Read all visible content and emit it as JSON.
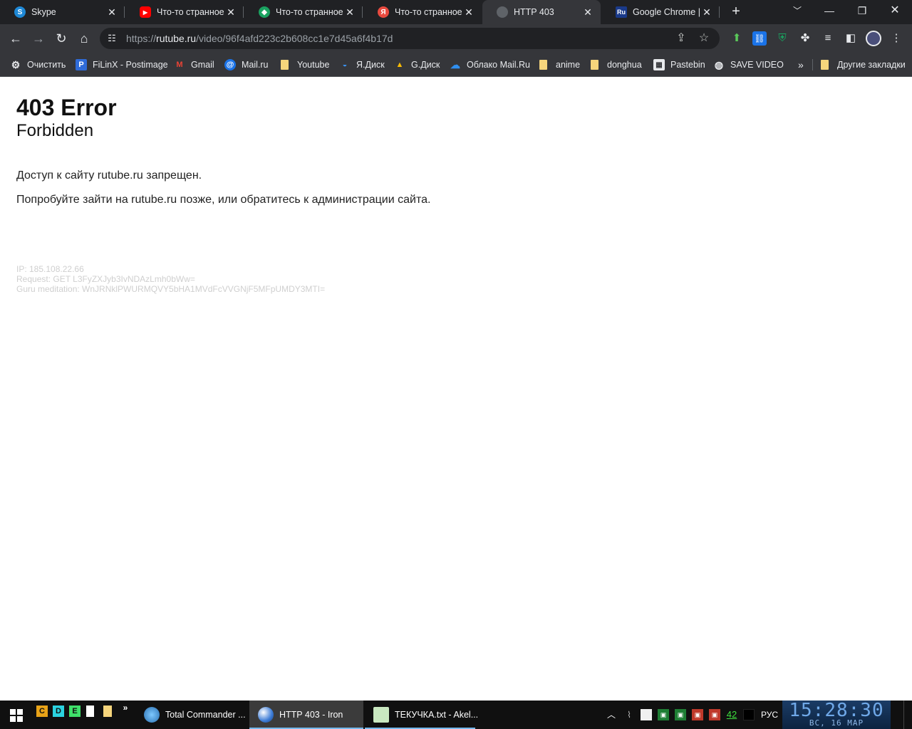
{
  "tabs": [
    {
      "title": "Skype",
      "icon": "skype-icon",
      "color": "#1e88d6",
      "glyph": "S"
    },
    {
      "title": "Что-то странное п",
      "icon": "youtube-icon",
      "color": "#ff0000",
      "glyph": "▶"
    },
    {
      "title": "Что-то странное п",
      "icon": "green-app-icon",
      "color": "#1aa260",
      "glyph": "◆"
    },
    {
      "title": "Что-то странное п",
      "icon": "yandex-icon",
      "color": "#e84a3f",
      "glyph": "Я"
    },
    {
      "title": "HTTP 403",
      "icon": "globe-icon",
      "color": "#5f6368",
      "glyph": "●"
    },
    {
      "title": "Google Chrome | С",
      "icon": "ru-site-icon",
      "color": "#1a3a8a",
      "glyph": "Ru"
    }
  ],
  "toolbar": {
    "url_scheme": "https://",
    "url_host": "rutube.ru",
    "url_path": "/video/96f4afd223c2b608cc1e7d45a6f4b17d"
  },
  "bookmarks": [
    {
      "label": "Очистить",
      "icon": "gear-icon"
    },
    {
      "label": "FiLinX - Postimage",
      "icon": "postimage-icon"
    },
    {
      "label": "Gmail",
      "icon": "gmail-icon"
    },
    {
      "label": "Mail.ru",
      "icon": "at-icon"
    },
    {
      "label": "Youtube",
      "icon": "folder-icon"
    },
    {
      "label": "Я.Диск",
      "icon": "yadisk-icon"
    },
    {
      "label": "G.Диск",
      "icon": "gdrive-icon"
    },
    {
      "label": "Облако Mail.Ru",
      "icon": "cloud-icon"
    },
    {
      "label": "anime",
      "icon": "folder-icon"
    },
    {
      "label": "donghua",
      "icon": "folder-icon"
    },
    {
      "label": "Pastebin",
      "icon": "pastebin-icon"
    },
    {
      "label": "SAVE VIDEO",
      "icon": "globe-icon"
    }
  ],
  "other_bookmarks": "Другие закладки",
  "page": {
    "heading": "403 Error",
    "subheading": "Forbidden",
    "paragraph1": "Доступ к сайту rutube.ru запрещен.",
    "paragraph2": "Попробуйте зайти на rutube.ru позже, или обратитесь к администрации сайта.",
    "ip": "IP: 185.108.22.66",
    "request": "Request: GET L3FyZXJyb3IvNDAzLmh0bWw=",
    "guru": "Guru meditation: WnJRNklPWURMQVY5bHA1MVdFcVVGNjF5MFpUMDY3MTI="
  },
  "taskbar": {
    "quicklaunch": [
      "C",
      "D",
      "E"
    ],
    "tasks": [
      {
        "label": "Total Commander ...",
        "active": false
      },
      {
        "label": "HTTP 403 - Iron",
        "active": true
      },
      {
        "label": "ТЕКУЧКА.txt - Akel...",
        "active": false
      }
    ],
    "tray_number": "42",
    "language": "РУС",
    "clock_time": "15:28:30",
    "clock_date": "ВС, 16 МАР"
  }
}
